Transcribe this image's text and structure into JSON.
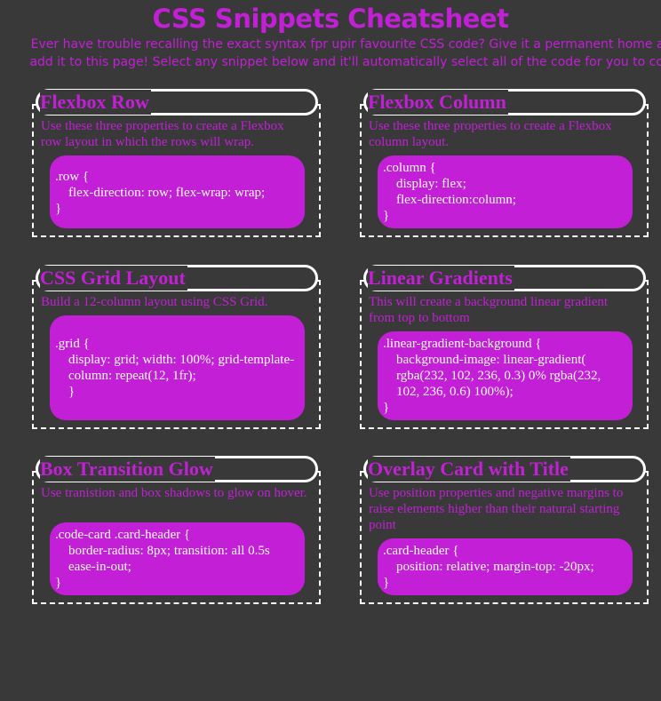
{
  "header": {
    "title": "CSS Snippets Cheatsheet",
    "intro": "Ever have trouble recalling the exact syntax fpr upir favourite CSS code? Give it a permanent home and add it to this page! Select any snippet below and it'll automatically select all of the code for you to copy."
  },
  "cards": [
    {
      "title": "Flexbox Row",
      "description": "Use these three properties to create a Flexbox row layout in which the rows will wrap.",
      "code_open": ".row {",
      "code_body": "flex-direction: row; flex-wrap: wrap;",
      "code_close": "}"
    },
    {
      "title": "Flexbox Column",
      "description": "Use these three properties to create a Flexbox column layout.",
      "code_open": ".column {",
      "code_body_1": "display: flex;",
      "code_body_2": "flex-direction:column;",
      "code_close": "}"
    },
    {
      "title": "CSS Grid Layout",
      "description": "Build a 12-column layout using CSS Grid.",
      "code_open": ".grid {",
      "code_body": "display: grid; width: 100%; grid-template-column: repeat(12, 1fr);",
      "code_close": "}"
    },
    {
      "title": "Linear Gradients",
      "description": "This will create a background linear gradient from top to bottom",
      "code_open": ".linear-gradient-background {",
      "code_body": "background-image: linear-gradient( rgba(232, 102, 236, 0.3) 0% rgba(232, 102, 236, 0.6) 100%);",
      "code_close": "}"
    },
    {
      "title": "Box Transition Glow",
      "description": "Use tranistion and box shadows to glow on hover.",
      "code_open": ".code-card .card-header {",
      "code_body": "border-radius: 8px; transition: all 0.5s ease-in-out;",
      "code_close": "}"
    },
    {
      "title": "Overlay Card with Title",
      "description": "Use position properties and negative margins to raise elements higher than their natural starting point",
      "code_open": ".card-header {",
      "code_body": "position: relative; margin-top: -20px;",
      "code_close": "}"
    }
  ],
  "colors": {
    "background": "#393939",
    "accent": "#c21fd6",
    "border": "#ffffff",
    "code_text": "#ffffff"
  }
}
